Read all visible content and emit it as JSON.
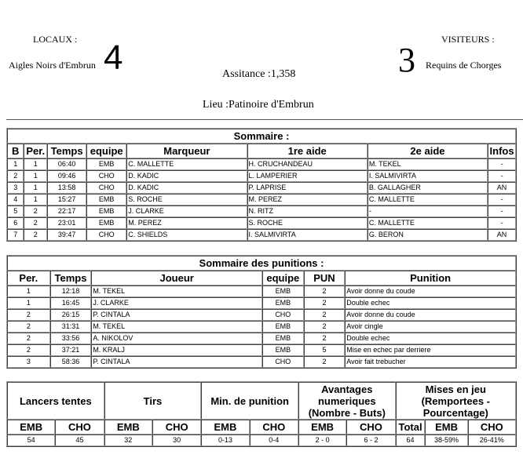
{
  "header": {
    "home_label": "LOCAUX :",
    "home_team": "Aigles Noirs d'Embrun",
    "home_score": "4",
    "away_label": "VISITEURS :",
    "away_team": "Requins de Chorges",
    "away_score": "3",
    "attendance": "Assitance :1,358",
    "venue": "Lieu :Patinoire d'Embrun"
  },
  "goals": {
    "title": "Sommaire :",
    "columns": [
      "B",
      "Per.",
      "Temps",
      "equipe",
      "Marqueur",
      "1re aide",
      "2e aide",
      "Infos"
    ],
    "rows": [
      [
        "1",
        "1",
        "06:40",
        "EMB",
        "C. MALLETTE",
        "H. CRUCHANDEAU",
        "M. TEKEL",
        "-"
      ],
      [
        "2",
        "1",
        "09:46",
        "CHO",
        "D. KADIC",
        "L. LAMPERIER",
        "I. SALMIVIRTA",
        "-"
      ],
      [
        "3",
        "1",
        "13:58",
        "CHO",
        "D. KADIC",
        "P. LAPRISE",
        "B. GALLAGHER",
        "AN"
      ],
      [
        "4",
        "1",
        "15:27",
        "EMB",
        "S. ROCHE",
        "M. PEREZ",
        "C. MALLETTE",
        "-"
      ],
      [
        "5",
        "2",
        "22:17",
        "EMB",
        "J. CLARKE",
        "N. RITZ",
        "-",
        "-"
      ],
      [
        "6",
        "2",
        "23:01",
        "EMB",
        "M. PEREZ",
        "S. ROCHE",
        "C. MALLETTE",
        "-"
      ],
      [
        "7",
        "2",
        "39:47",
        "CHO",
        "C. SHIELDS",
        "I. SALMIVIRTA",
        "G. BERON",
        "AN"
      ]
    ]
  },
  "penalties": {
    "title": "Sommaire des punitions :",
    "columns": [
      "Per.",
      "Temps",
      "Joueur",
      "equipe",
      "PUN",
      "Punition"
    ],
    "rows": [
      [
        "1",
        "12:18",
        "M. TEKEL",
        "EMB",
        "2",
        "Avoir donne du coude"
      ],
      [
        "1",
        "16:45",
        "J. CLARKE",
        "EMB",
        "2",
        "Double echec"
      ],
      [
        "2",
        "26:15",
        "P. CINTALA",
        "CHO",
        "2",
        "Avoir donne du coude"
      ],
      [
        "2",
        "31:31",
        "M. TEKEL",
        "EMB",
        "2",
        "Avoir cingle"
      ],
      [
        "2",
        "33:56",
        "A. NIKOLOV",
        "EMB",
        "2",
        "Double echec"
      ],
      [
        "2",
        "37:21",
        "M. KRALJ",
        "EMB",
        "5",
        "Mise en echec par derriere"
      ],
      [
        "3",
        "58:36",
        "P. CINTALA",
        "CHO",
        "2",
        "Avoir fait trebucher"
      ]
    ]
  },
  "stats": {
    "groups": [
      "Lancers tentes",
      "Tirs",
      "Min. de punition",
      "Avantages numeriques (Nombre - Buts)",
      "Mises en jeu (Remportees - Pourcentage)"
    ],
    "subheaders": [
      "EMB",
      "CHO",
      "EMB",
      "CHO",
      "EMB",
      "CHO",
      "EMB",
      "CHO",
      "Total",
      "EMB",
      "CHO"
    ],
    "values": [
      "54",
      "45",
      "32",
      "30",
      "0-13",
      "0-4",
      "2 - 0",
      "6 - 2",
      "64",
      "38-59%",
      "26-41%"
    ]
  }
}
